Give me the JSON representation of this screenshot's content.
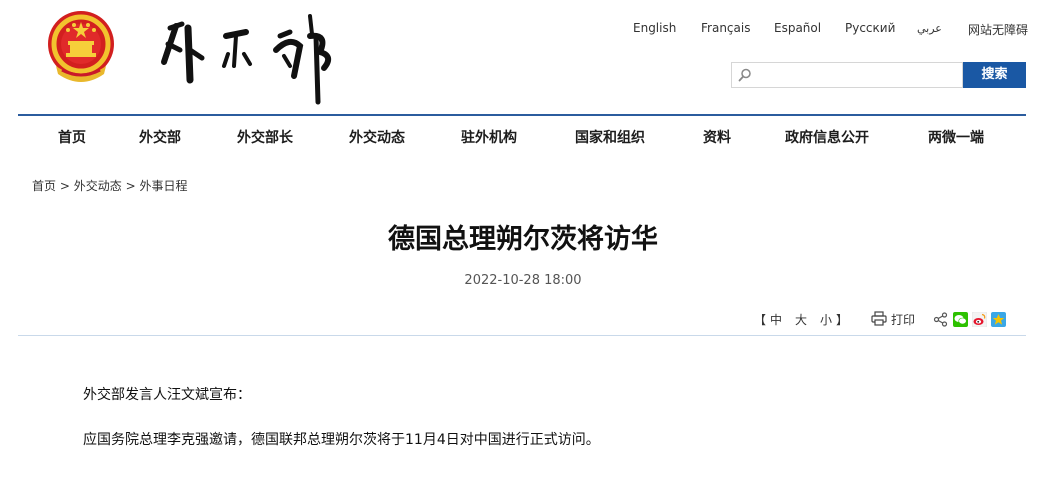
{
  "header": {
    "emblem_name": "national-emblem",
    "logo_text": "外交部",
    "languages": [
      "English",
      "Français",
      "Español",
      "Русский",
      "عربي",
      "网站无障碍"
    ],
    "search": {
      "placeholder": "",
      "button_label": "搜索"
    }
  },
  "nav": {
    "items": [
      "首页",
      "外交部",
      "外交部长",
      "外交动态",
      "驻外机构",
      "国家和组织",
      "资料",
      "政府信息公开",
      "两微一端"
    ]
  },
  "breadcrumb": {
    "items": [
      "首页",
      "外交动态",
      "外事日程"
    ],
    "separator": ">"
  },
  "article": {
    "title": "德国总理朔尔茨将访华",
    "date": "2022-10-28 18:00",
    "paragraphs": [
      "外交部发言人汪文斌宣布：",
      "应国务院总理李克强邀请，德国联邦总理朔尔茨将于11月4日对中国进行正式访问。"
    ]
  },
  "tools": {
    "bracket_open": "【",
    "bracket_close": "】",
    "font_sizes": [
      "中",
      "大",
      "小"
    ],
    "print_label": "打印",
    "share_icons": [
      "share-icon",
      "wechat-icon",
      "weibo-icon",
      "qzone-icon"
    ]
  },
  "colors": {
    "accent": "#1a58a4",
    "nav_rule": "#2b5c9e",
    "wechat": "#2dc100",
    "weibo": "#e6162d",
    "qzone": "#f5c400"
  }
}
